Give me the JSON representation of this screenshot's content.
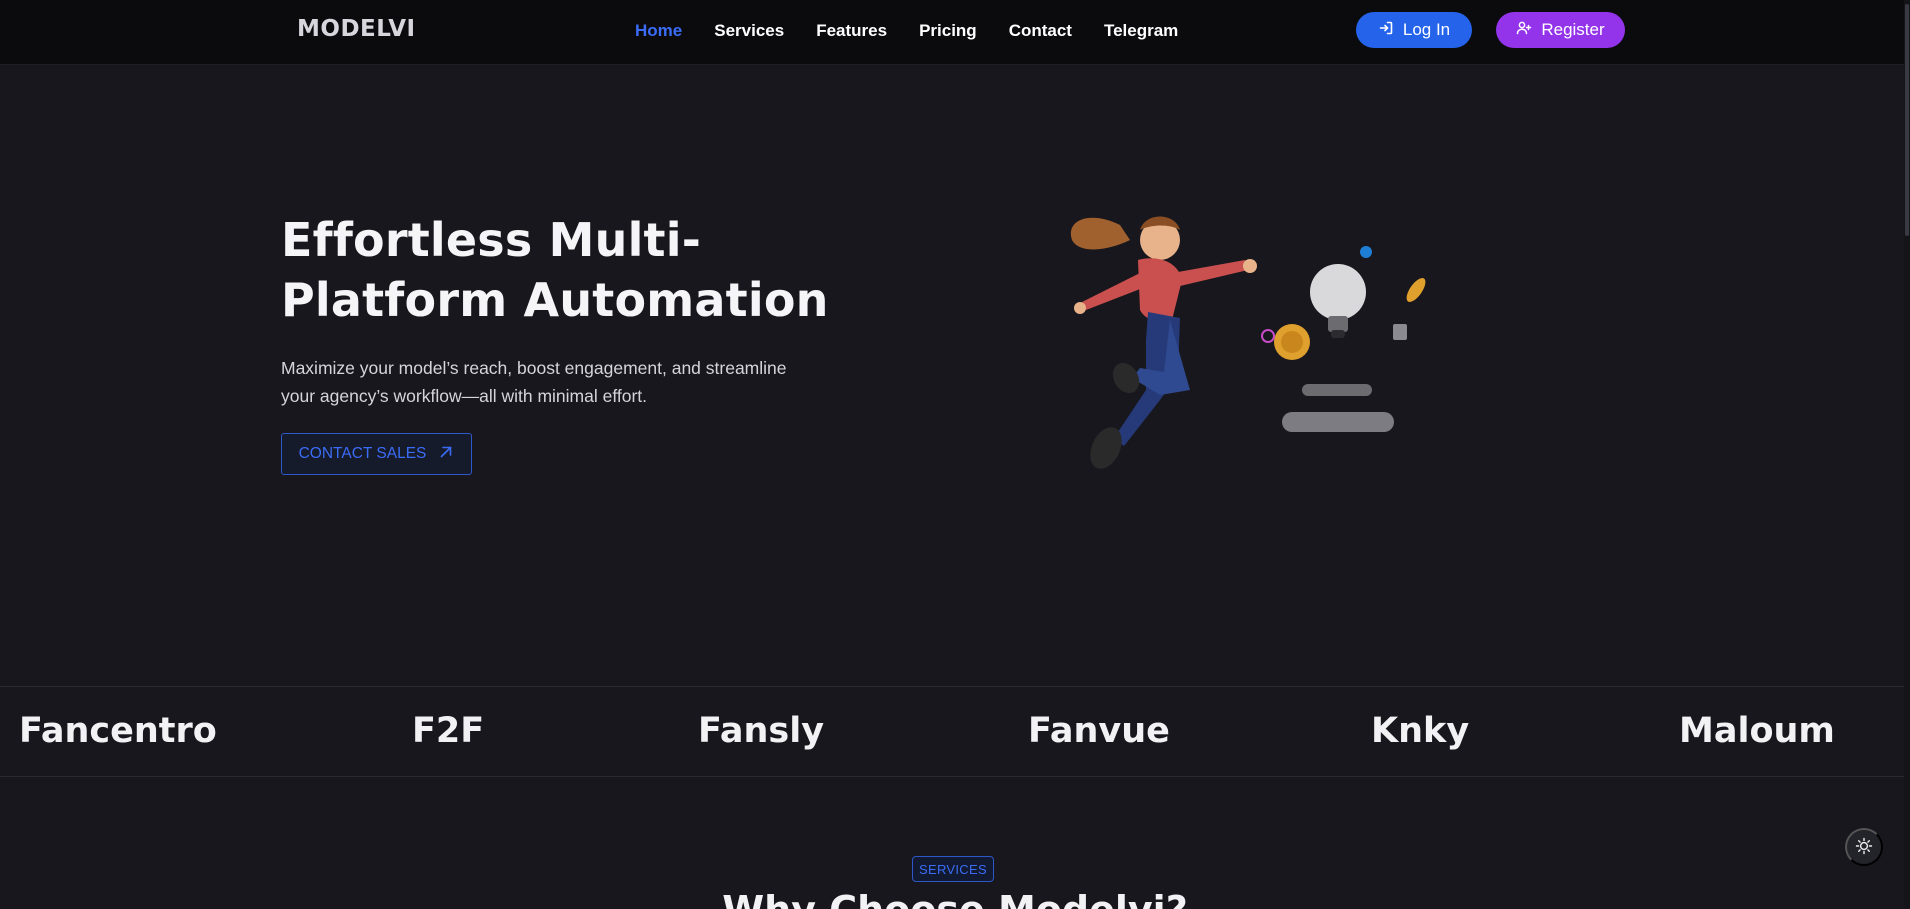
{
  "brand": {
    "logo": "MODELVI"
  },
  "nav": {
    "links": [
      "Home",
      "Services",
      "Features",
      "Pricing",
      "Contact",
      "Telegram"
    ],
    "active": "Home",
    "login_label": "Log In",
    "register_label": "Register"
  },
  "hero": {
    "title": "Effortless Multi-Platform Automation",
    "subtitle": "Maximize your model’s reach, boost engagement, and streamline your agency’s workflow—all with minimal effort.",
    "cta_label": "CONTACT SALES",
    "illustration": "3d-woman-leaping-with-lightbulb-and-coins"
  },
  "platforms": [
    "Fancentro",
    "F2F",
    "Fansly",
    "Fanvue",
    "Knky",
    "Maloum"
  ],
  "services": {
    "badge": "SERVICES",
    "title": "Why Choose Modelvi?"
  },
  "icons": {
    "login": "login-arrow-icon",
    "register": "user-plus-icon",
    "cta": "arrow-up-right-icon",
    "theme": "sun-icon"
  },
  "colors": {
    "accent": "#3b6cf6",
    "login_bg": "#2563eb",
    "register_bg": "#9333ea",
    "background": "#18171d",
    "navbar_bg": "#0b0b0e"
  }
}
